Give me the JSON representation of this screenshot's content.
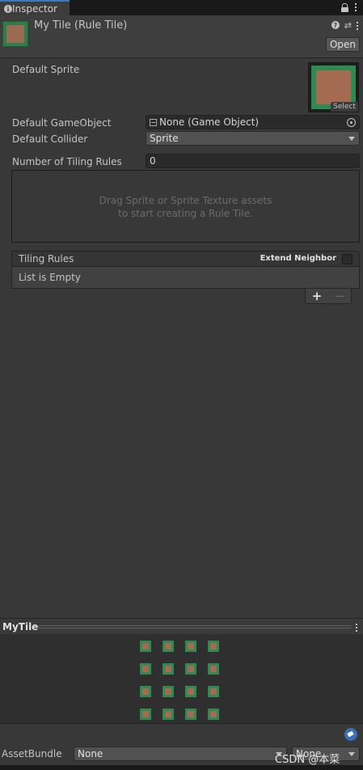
{
  "tab": {
    "label": "Inspector"
  },
  "header": {
    "title": "My Tile (Rule Tile)",
    "open_label": "Open"
  },
  "fields": {
    "default_sprite_label": "Default Sprite",
    "sprite_select_label": "Select",
    "default_gameobject_label": "Default GameObject",
    "default_gameobject_value": "None (Game Object)",
    "default_collider_label": "Default Collider",
    "default_collider_value": "Sprite",
    "num_rules_label": "Number of Tiling Rules",
    "num_rules_value": "0"
  },
  "drop_area": {
    "line1": "Drag Sprite or Sprite Texture assets",
    "line2": "to start creating a Rule Tile."
  },
  "tiling_rules": {
    "title": "Tiling Rules",
    "extend_neighbor_label": "Extend Neighbor",
    "extend_neighbor_checked": false,
    "empty_text": "List is Empty",
    "add_label": "+",
    "remove_label": "−"
  },
  "preview": {
    "title": "MyTile",
    "tile_count": 16
  },
  "asset_bundle": {
    "label": "AssetBundle",
    "value": "None",
    "variant_value": "None"
  },
  "watermark": "CSDN @本菜",
  "colors": {
    "tab_accent": "#3a79bb",
    "tile_green": "#2f8a52",
    "tile_brown": "#a46b52",
    "tag_blue": "#3a6fb5"
  }
}
